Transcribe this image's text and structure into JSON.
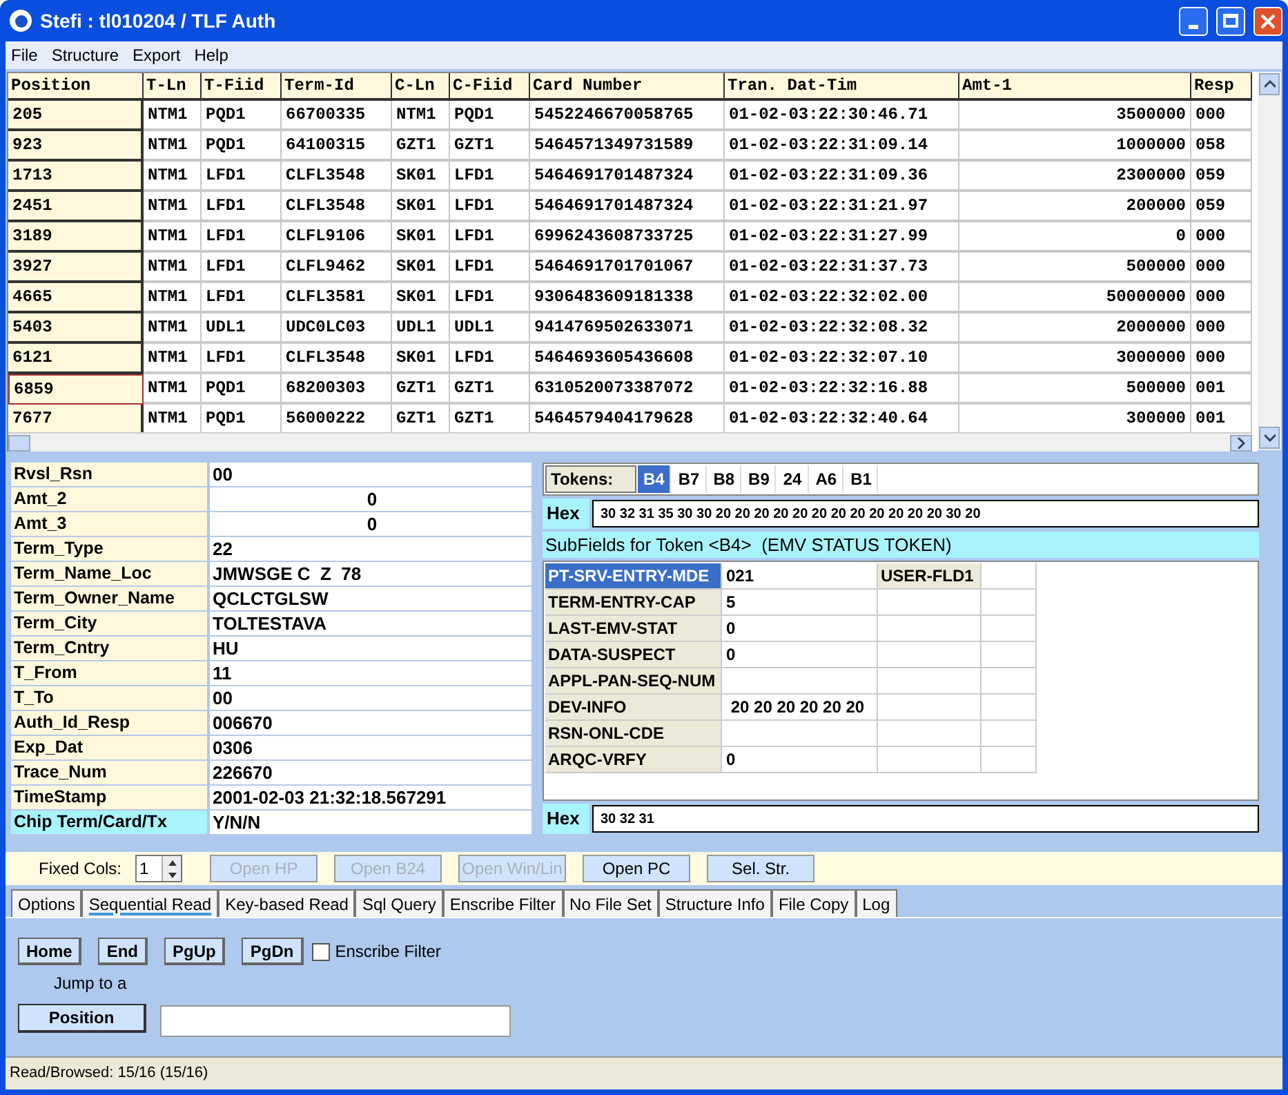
{
  "window": {
    "title": "Stefi : tl010204 / TLF Auth"
  },
  "menu": [
    "File",
    "Structure",
    "Export",
    "Help"
  ],
  "grid": {
    "columns": [
      {
        "label": "Position",
        "kind": "text"
      },
      {
        "label": "T-Ln",
        "kind": "text"
      },
      {
        "label": "T-Fiid",
        "kind": "text"
      },
      {
        "label": "Term-Id",
        "kind": "text"
      },
      {
        "label": "C-Ln",
        "kind": "text"
      },
      {
        "label": "C-Fiid",
        "kind": "text"
      },
      {
        "label": "Card Number",
        "kind": "text"
      },
      {
        "label": "Tran. Dat-Tim",
        "kind": "text"
      },
      {
        "label": "Amt-1",
        "kind": "number"
      },
      {
        "label": "Resp",
        "kind": "text"
      }
    ],
    "rows": [
      {
        "focused": false,
        "cells": [
          "205",
          "NTM1",
          "PQD1",
          "66700335",
          "NTM1",
          "PQD1",
          "5452246670058765",
          "01-02-03:22:30:46.71",
          "3500000",
          "000"
        ]
      },
      {
        "focused": false,
        "cells": [
          "923",
          "NTM1",
          "PQD1",
          "64100315",
          "GZT1",
          "GZT1",
          "5464571349731589",
          "01-02-03:22:31:09.14",
          "1000000",
          "058"
        ]
      },
      {
        "focused": false,
        "cells": [
          "1713",
          "NTM1",
          "LFD1",
          "CLFL3548",
          "SK01",
          "LFD1",
          "5464691701487324",
          "01-02-03:22:31:09.36",
          "2300000",
          "059"
        ]
      },
      {
        "focused": false,
        "cells": [
          "2451",
          "NTM1",
          "LFD1",
          "CLFL3548",
          "SK01",
          "LFD1",
          "5464691701487324",
          "01-02-03:22:31:21.97",
          "200000",
          "059"
        ]
      },
      {
        "focused": false,
        "cells": [
          "3189",
          "NTM1",
          "LFD1",
          "CLFL9106",
          "SK01",
          "LFD1",
          "6996243608733725",
          "01-02-03:22:31:27.99",
          "0",
          "000"
        ]
      },
      {
        "focused": false,
        "cells": [
          "3927",
          "NTM1",
          "LFD1",
          "CLFL9462",
          "SK01",
          "LFD1",
          "5464691701701067",
          "01-02-03:22:31:37.73",
          "500000",
          "000"
        ]
      },
      {
        "focused": false,
        "cells": [
          "4665",
          "NTM1",
          "LFD1",
          "CLFL3581",
          "SK01",
          "LFD1",
          "9306483609181338",
          "01-02-03:22:32:02.00",
          "50000000",
          "000"
        ]
      },
      {
        "focused": false,
        "cells": [
          "5403",
          "NTM1",
          "UDL1",
          "UDC0LC03",
          "UDL1",
          "UDL1",
          "9414769502633071",
          "01-02-03:22:32:08.32",
          "2000000",
          "000"
        ]
      },
      {
        "focused": false,
        "cells": [
          "6121",
          "NTM1",
          "LFD1",
          "CLFL3548",
          "SK01",
          "LFD1",
          "5464693605436608",
          "01-02-03:22:32:07.10",
          "3000000",
          "000"
        ]
      },
      {
        "focused": true,
        "cells": [
          "6859",
          "NTM1",
          "PQD1",
          "68200303",
          "GZT1",
          "GZT1",
          "6310520073387072",
          "01-02-03:22:32:16.88",
          "500000",
          "001"
        ]
      },
      {
        "focused": false,
        "cells": [
          "7677",
          "NTM1",
          "PQD1",
          "56000222",
          "GZT1",
          "GZT1",
          "5464579404179628",
          "01-02-03:22:32:40.64",
          "300000",
          "001"
        ]
      }
    ]
  },
  "details": [
    {
      "label": "Rvsl_Rsn",
      "value": "00",
      "kind": "text",
      "highlighted": false
    },
    {
      "label": "Amt_2",
      "value": "0",
      "kind": "amount",
      "highlighted": false
    },
    {
      "label": "Amt_3",
      "value": "0",
      "kind": "amount",
      "highlighted": false
    },
    {
      "label": "Term_Type",
      "value": "22",
      "kind": "text",
      "highlighted": false
    },
    {
      "label": "Term_Name_Loc",
      "value": "JMWSGE C  Z  78",
      "kind": "text",
      "highlighted": false
    },
    {
      "label": "Term_Owner_Name",
      "value": "QCLCTGLSW",
      "kind": "text",
      "highlighted": false
    },
    {
      "label": "Term_City",
      "value": "TOLTESTAVA",
      "kind": "text",
      "highlighted": false
    },
    {
      "label": "Term_Cntry",
      "value": "HU",
      "kind": "text",
      "highlighted": false
    },
    {
      "label": "T_From",
      "value": "11",
      "kind": "text",
      "highlighted": false
    },
    {
      "label": "T_To",
      "value": "00",
      "kind": "text",
      "highlighted": false
    },
    {
      "label": "Auth_Id_Resp",
      "value": "006670",
      "kind": "text",
      "highlighted": false
    },
    {
      "label": "Exp_Dat",
      "value": "0306",
      "kind": "text",
      "highlighted": false
    },
    {
      "label": "Trace_Num",
      "value": "226670",
      "kind": "text",
      "highlighted": false
    },
    {
      "label": "TimeStamp",
      "value": "2001-02-03 21:32:18.567291",
      "kind": "text",
      "highlighted": false
    },
    {
      "label": "Chip Term/Card/Tx",
      "value": "Y/N/N",
      "kind": "text",
      "highlighted": true
    }
  ],
  "tokens": {
    "label": "Tokens:",
    "items": [
      {
        "label": "B4",
        "selected": true
      },
      {
        "label": "B7",
        "selected": false
      },
      {
        "label": "B8",
        "selected": false
      },
      {
        "label": "B9",
        "selected": false
      },
      {
        "label": "24",
        "selected": false
      },
      {
        "label": "A6",
        "selected": false
      },
      {
        "label": "B1",
        "selected": false
      }
    ]
  },
  "hex_top": {
    "label": "Hex",
    "value": "30 32 31 35 30 30 20 20 20 20 20 20 20 20 20 20 20 20 30 20"
  },
  "subfields": {
    "title": "SubFields for Token <B4>  (EMV STATUS TOKEN)",
    "rows": [
      {
        "name": "PT-SRV-ENTRY-MDE",
        "value": "021",
        "selected": true,
        "extra": "USER-FLD1"
      },
      {
        "name": "TERM-ENTRY-CAP",
        "value": "5",
        "selected": false
      },
      {
        "name": "LAST-EMV-STAT",
        "value": "0",
        "selected": false
      },
      {
        "name": "DATA-SUSPECT",
        "value": "0",
        "selected": false
      },
      {
        "name": "APPL-PAN-SEQ-NUM",
        "selected": false
      },
      {
        "name": "DEV-INFO",
        "value": " 20 20 20 20 20 20",
        "selected": false
      },
      {
        "name": "RSN-ONL-CDE",
        "selected": false
      },
      {
        "name": "ARQC-VRFY",
        "value": "0",
        "selected": false
      }
    ]
  },
  "hex_bottom": {
    "label": "Hex",
    "value": "30 32 31"
  },
  "toolbar": {
    "label": "Fixed Cols:",
    "value": "1",
    "buttons": [
      {
        "label": "Open HP",
        "disabled": true
      },
      {
        "label": "Open B24",
        "disabled": true
      },
      {
        "label": "Open Win/Lin",
        "disabled": true
      },
      {
        "label": "Open PC",
        "disabled": false
      },
      {
        "label": "Sel. Str.",
        "disabled": false
      }
    ]
  },
  "tabs": [
    {
      "label": "Options",
      "selected": false
    },
    {
      "label": "Sequential Read",
      "selected": true
    },
    {
      "label": "Key-based Read",
      "selected": false
    },
    {
      "label": "Sql Query",
      "selected": false
    },
    {
      "label": "Enscribe Filter",
      "selected": false
    },
    {
      "label": "No File Set",
      "selected": false
    },
    {
      "label": "Structure Info",
      "selected": false
    },
    {
      "label": "File Copy",
      "selected": false
    },
    {
      "label": "Log",
      "selected": false
    }
  ],
  "sequential_read": {
    "nav_buttons": [
      "Home",
      "End",
      "PgUp",
      "PgDn"
    ],
    "filter": {
      "label": "Enscribe Filter",
      "checked": false
    },
    "jump_label": "Jump to a",
    "position_button": "Position"
  },
  "status_bar": "Read/Browsed: 15/16 (15/16)"
}
